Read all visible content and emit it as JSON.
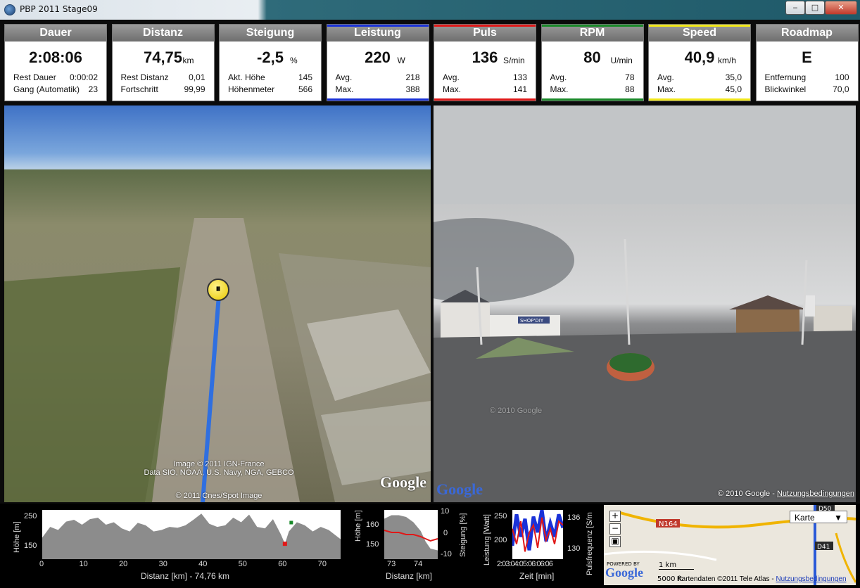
{
  "window": {
    "title": "PBP 2011 Stage09",
    "min_label": "‒",
    "max_label": "□",
    "close_label": "✕"
  },
  "tiles": [
    {
      "title": "Dauer",
      "value": "2:08:06",
      "unit": "",
      "color": "#7a7a7a",
      "rows": [
        {
          "label": "Rest Dauer",
          "value": "0:00:02"
        },
        {
          "label": "Gang (Automatik)",
          "value": "23"
        }
      ]
    },
    {
      "title": "Distanz",
      "value": "74,75",
      "unit": "km",
      "color": "#7a7a7a",
      "rows": [
        {
          "label": "Rest Distanz",
          "value": "0,01"
        },
        {
          "label": "Fortschritt",
          "value": "99,99"
        }
      ]
    },
    {
      "title": "Steigung",
      "value": "-2,5",
      "unit": "%",
      "color": "#7a7a7a",
      "rows": [
        {
          "label": "Akt. Höhe",
          "value": "145"
        },
        {
          "label": "Höhenmeter",
          "value": "566"
        }
      ]
    },
    {
      "title": "Leistung",
      "value": "220",
      "unit": "W",
      "color": "#1a32d8",
      "rows": [
        {
          "label": "Avg.",
          "value": "218"
        },
        {
          "label": "Max.",
          "value": "388"
        }
      ]
    },
    {
      "title": "Puls",
      "value": "136",
      "unit": "S/min",
      "color": "#e01818",
      "rows": [
        {
          "label": "Avg.",
          "value": "133"
        },
        {
          "label": "Max.",
          "value": "141"
        }
      ]
    },
    {
      "title": "RPM",
      "value": "80",
      "unit": "U/min",
      "color": "#1a8a2a",
      "rows": [
        {
          "label": "Avg.",
          "value": "78"
        },
        {
          "label": "Max.",
          "value": "88"
        }
      ]
    },
    {
      "title": "Speed",
      "value": "40,9",
      "unit": "km/h",
      "color": "#f2e81a",
      "rows": [
        {
          "label": "Avg.",
          "value": "35,0"
        },
        {
          "label": "Max.",
          "value": "45,0"
        }
      ]
    },
    {
      "title": "Roadmap",
      "value": "E",
      "unit": "",
      "color": "#7a7a7a",
      "rows": [
        {
          "label": "Entfernung",
          "value": "100"
        },
        {
          "label": "Blickwinkel",
          "value": "70,0"
        }
      ]
    }
  ],
  "earth": {
    "copyright_lines": [
      "Image © 2011 IGN-France",
      "Data SIO, NOAA, U.S. Navy, NGA, GEBCO"
    ],
    "copyright_bottom": "© 2011 Cnes/Spot Image",
    "logo": "Google"
  },
  "street": {
    "copyright": "© 2010 Google -",
    "terms_link": "Nutzungsbedingungen",
    "logo": "Google",
    "shop_sign": "SHOP'DIY",
    "watermark": "© 2010 Google"
  },
  "elevation_chart": {
    "ylabel": "Höhe [m]",
    "xlabel": "Distanz [km] - 74,76 km",
    "yticks": [
      "250",
      "150"
    ],
    "xticks": [
      "0",
      "10",
      "20",
      "30",
      "40",
      "50",
      "60",
      "70"
    ]
  },
  "zoom_chart": {
    "ylabel_left": "Höhe [m]",
    "ylabel_right": "Steigung [%]",
    "xlabel": "Distanz [km]",
    "yticks_left": [
      "160",
      "150"
    ],
    "yticks_right": [
      "10",
      "0",
      "-10"
    ],
    "xticks": [
      "73",
      "74"
    ]
  },
  "power_chart": {
    "ylabel_left": "Leistung [Watt]",
    "ylabel_right": "Pulsfrequenz [S/m",
    "xlabel": "Zeit [min]",
    "yticks_left": [
      "250",
      "200",
      "150"
    ],
    "yticks_right": [
      "136",
      "130"
    ],
    "xticks_overlap": "2:03:04:05:06:06:06"
  },
  "minimap": {
    "maptype": "Karte",
    "road_label": "N164",
    "road_label2": "D41",
    "road_label3": "D50",
    "powered_by": "POWERED BY",
    "logo": "Google",
    "scale_km": "1 km",
    "scale_ft": "5000 ft",
    "attribution": "Kartendaten ©2011 Tele Atlas -",
    "terms_link": "Nutzungsbedingungen",
    "zoom_in": "+",
    "zoom_out": "−",
    "zoom_reset": "▣"
  },
  "chart_data": [
    {
      "type": "area",
      "title": "",
      "xlabel": "Distanz [km] - 74,76 km",
      "ylabel": "Höhe [m]",
      "xlim": [
        0,
        75
      ],
      "ylim": [
        110,
        270
      ],
      "x": [
        0,
        2,
        4,
        6,
        8,
        10,
        12,
        14,
        16,
        18,
        20,
        22,
        24,
        26,
        28,
        30,
        32,
        34,
        36,
        38,
        40,
        42,
        44,
        46,
        48,
        50,
        52,
        54,
        56,
        58,
        60,
        61,
        62,
        64,
        66,
        68,
        70,
        72,
        74,
        75
      ],
      "series": [
        {
          "values": [
            180,
            215,
            205,
            232,
            238,
            222,
            240,
            245,
            222,
            230,
            210,
            200,
            228,
            220,
            200,
            205,
            215,
            212,
            220,
            238,
            258,
            225,
            215,
            220,
            245,
            230,
            255,
            215,
            210,
            240,
            190,
            160,
            200,
            230,
            220,
            200,
            215,
            205,
            185,
            175
          ]
        }
      ]
    },
    {
      "type": "line",
      "xlabel": "Distanz [km]",
      "ylabel": "Höhe [m]",
      "xlim": [
        72.6,
        74.8
      ],
      "ylim": [
        140,
        168
      ],
      "x": [
        72.6,
        72.9,
        73.2,
        73.5,
        73.8,
        74.1,
        74.3,
        74.5,
        74.8
      ],
      "series": [
        {
          "values": [
            163,
            165,
            165,
            164,
            161,
            156,
            150,
            146,
            145
          ]
        },
        {
          "values": [
            2,
            1,
            1,
            0,
            0,
            -1,
            -2,
            -3,
            -2
          ]
        }
      ]
    },
    {
      "type": "line",
      "xlabel": "Zeit [min]",
      "ylabel": "Leistung [Watt]",
      "ylim": [
        150,
        260
      ],
      "x": [
        0,
        1,
        2,
        3,
        4,
        5,
        6,
        7,
        8,
        9,
        10,
        11,
        12
      ],
      "series": [
        {
          "values": [
            180,
            250,
            200,
            240,
            170,
            245,
            210,
            260,
            190,
            230,
            200,
            250,
            220
          ]
        },
        {
          "values": [
            135,
            131,
            137,
            129,
            134,
            136,
            130,
            138,
            132,
            135,
            131,
            137,
            136
          ]
        }
      ]
    }
  ]
}
